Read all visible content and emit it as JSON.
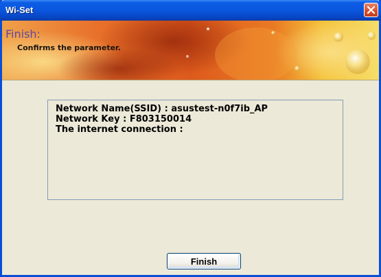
{
  "window": {
    "title": "Wi-Set",
    "close_label": "✕"
  },
  "header": {
    "heading": "Finish:",
    "subtitle": "Confirms the parameter."
  },
  "info": {
    "ssid_line": "Network Name(SSID) : asustest-n0f7ib_AP",
    "key_line": "Network Key : F803150014",
    "connection_line": "The internet connection :"
  },
  "buttons": {
    "finish_label": "Finish"
  },
  "colors": {
    "titlebar": "#0a56df",
    "close_button": "#d9512b",
    "dialog_background": "#ece9d8",
    "heading_text": "#5d4aa0"
  }
}
